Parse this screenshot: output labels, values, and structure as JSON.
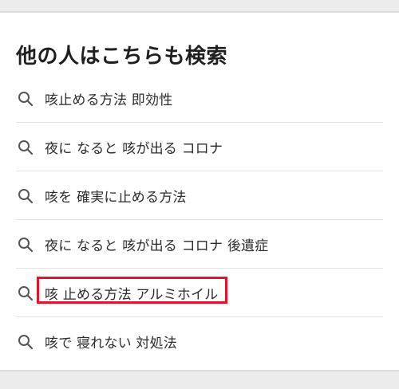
{
  "section": {
    "title": "他の人はこちらも検索"
  },
  "related_searches": [
    {
      "label": "咳止める方法 即効性",
      "icon": "search-icon",
      "highlighted": false
    },
    {
      "label": "夜に なると 咳が出る コロナ",
      "icon": "search-icon",
      "highlighted": false
    },
    {
      "label": "咳を 確実に止める方法",
      "icon": "search-icon",
      "highlighted": false
    },
    {
      "label": "夜に なると 咳が出る コロナ 後遺症",
      "icon": "search-icon",
      "highlighted": false
    },
    {
      "label": "咳 止める方法 アルミホイル",
      "icon": "search-icon",
      "highlighted": true
    },
    {
      "label": "咳で 寝れない 対処法",
      "icon": "search-icon",
      "highlighted": false
    }
  ],
  "colors": {
    "highlight_border": "#e8112b",
    "divider_band": "#ececec",
    "separator": "#e2e2e2",
    "icon": "#555555",
    "text": "#2b2b2b"
  }
}
